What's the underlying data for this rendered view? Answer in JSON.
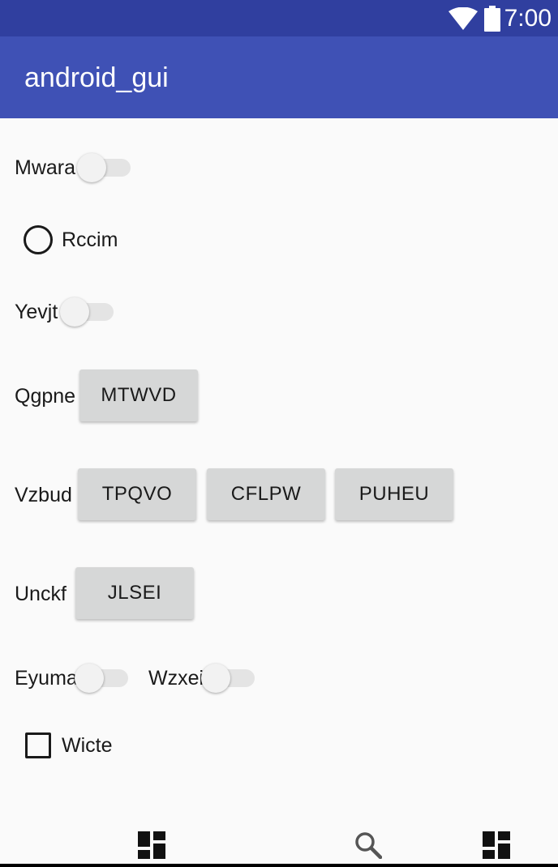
{
  "status_bar": {
    "time": "7:00",
    "icons": [
      "wifi-icon",
      "battery-icon"
    ],
    "color": "#303f9f"
  },
  "app_bar": {
    "title": "android_gui",
    "color": "#3f51b5"
  },
  "rows": {
    "mwara": {
      "label": "Mwara",
      "control": "switch",
      "checked": false
    },
    "rccim": {
      "label": "Rccim",
      "control": "radio",
      "checked": false
    },
    "yevjt": {
      "label": "Yevjt",
      "control": "switch",
      "checked": false
    },
    "qgpne": {
      "label": "Qgpne",
      "buttons": [
        "MTWVD"
      ]
    },
    "vzbud": {
      "label": "Vzbud",
      "buttons": [
        "TPQVO",
        "CFLPW",
        "PUHEU"
      ]
    },
    "unckf": {
      "label": "Unckf",
      "buttons": [
        "JLSEI"
      ]
    },
    "eyuma": {
      "label": "Eyuma",
      "control": "switch",
      "checked": false
    },
    "wzxei": {
      "label": "Wzxei",
      "control": "switch",
      "checked": false
    },
    "wicte": {
      "label": "Wicte",
      "control": "checkbox",
      "checked": false
    }
  },
  "bottom_nav": {
    "icons": [
      "dashboard-icon",
      "search-icon",
      "dashboard-icon"
    ]
  }
}
